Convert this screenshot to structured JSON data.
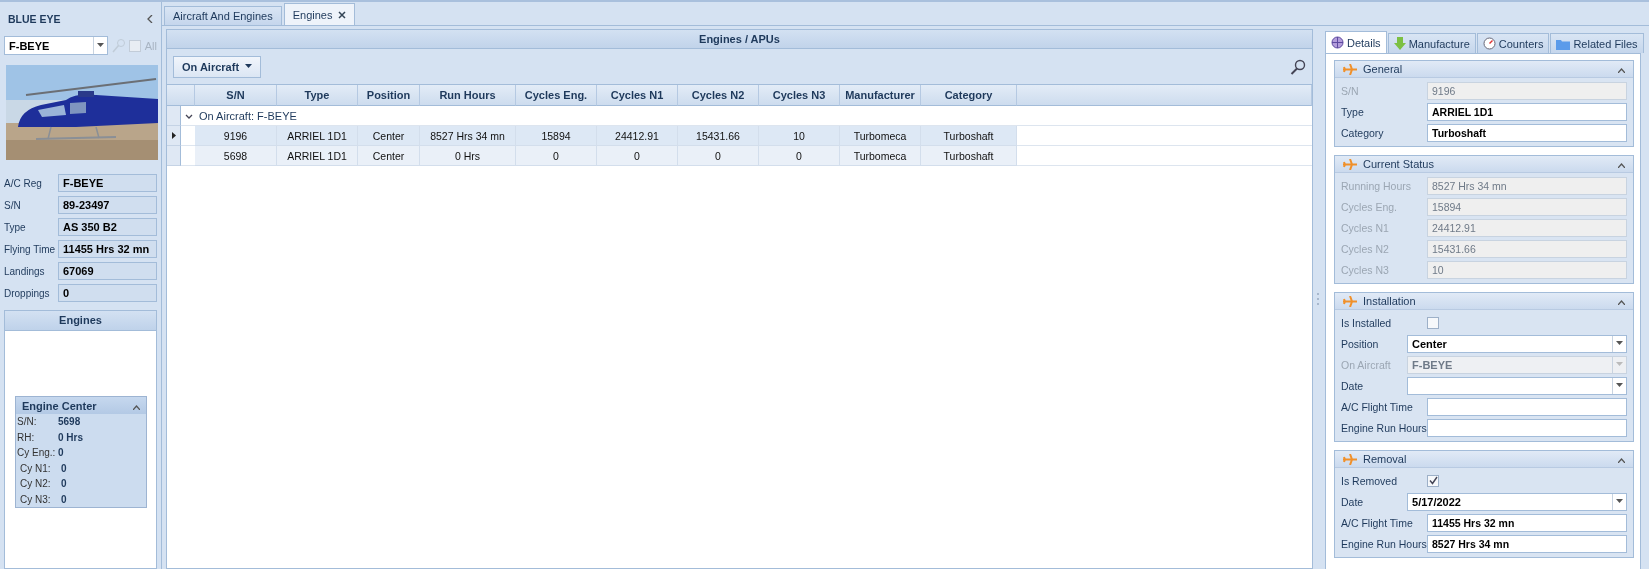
{
  "sidebar": {
    "title": "BLUE EYE",
    "aircraft_select": {
      "value": "F-BEYE"
    },
    "all_checkbox": {
      "label": "All",
      "checked": false,
      "disabled": true
    },
    "fields": [
      {
        "label": "A/C Reg",
        "value": "F-BEYE"
      },
      {
        "label": "S/N",
        "value": "89-23497"
      },
      {
        "label": "Type",
        "value": "AS 350 B2"
      },
      {
        "label": "Flying Time",
        "value": "11455 Hrs 32 mn"
      },
      {
        "label": "Landings",
        "value": "67069"
      },
      {
        "label": "Droppings",
        "value": "0"
      }
    ],
    "engines_panel": {
      "title": "Engines",
      "card": {
        "title": "Engine Center",
        "expanded": true,
        "rows": [
          {
            "label": "S/N:",
            "value": "5698"
          },
          {
            "label": "RH:",
            "value": "0 Hrs"
          },
          {
            "label": "Cy Eng.:",
            "value": "0"
          },
          {
            "label": "Cy N1:",
            "value": "0"
          },
          {
            "label": "Cy N2:",
            "value": "0"
          },
          {
            "label": "Cy N3:",
            "value": "0"
          }
        ]
      }
    }
  },
  "tabs": [
    {
      "label": "Aircraft And Engines",
      "selected": false,
      "closable": false
    },
    {
      "label": "Engines",
      "selected": true,
      "closable": true
    }
  ],
  "grid": {
    "title": "Engines / APUs",
    "filter_button": "On Aircraft",
    "columns": [
      "S/N",
      "Type",
      "Position",
      "Run Hours",
      "Cycles Eng.",
      "Cycles N1",
      "Cycles N2",
      "Cycles N3",
      "Manufacturer",
      "Category"
    ],
    "group": {
      "label": "On Aircraft: F-BEYE",
      "expanded": true
    },
    "rows": [
      {
        "selected": true,
        "cells": [
          "9196",
          "ARRIEL 1D1",
          "Center",
          "8527 Hrs 34 mn",
          "15894",
          "24412.91",
          "15431.66",
          "10",
          "Turbomeca",
          "Turboshaft"
        ]
      },
      {
        "selected": false,
        "cells": [
          "5698",
          "ARRIEL 1D1",
          "Center",
          "0 Hrs",
          "0",
          "0",
          "0",
          "0",
          "Turbomeca",
          "Turboshaft"
        ]
      }
    ]
  },
  "details": {
    "tabs": [
      {
        "label": "Details",
        "selected": true
      },
      {
        "label": "Manufacture",
        "selected": false
      },
      {
        "label": "Counters",
        "selected": false
      },
      {
        "label": "Related Files",
        "selected": false
      }
    ],
    "sections": [
      {
        "title": "General",
        "expanded": true,
        "fields": [
          {
            "kind": "text",
            "label": "S/N",
            "value": "9196",
            "disabled": true
          },
          {
            "kind": "text",
            "label": "Type",
            "value": "ARRIEL 1D1",
            "disabled": false
          },
          {
            "kind": "text",
            "label": "Category",
            "value": "Turboshaft",
            "disabled": false
          }
        ]
      },
      {
        "title": "Current Status",
        "expanded": true,
        "fields": [
          {
            "kind": "text",
            "label": "Running Hours",
            "value": "8527 Hrs 34 mn",
            "disabled": true
          },
          {
            "kind": "text",
            "label": "Cycles Eng.",
            "value": "15894",
            "disabled": true
          },
          {
            "kind": "text",
            "label": "Cycles N1",
            "value": "24412.91",
            "disabled": true
          },
          {
            "kind": "text",
            "label": "Cycles N2",
            "value": "15431.66",
            "disabled": true
          },
          {
            "kind": "text",
            "label": "Cycles N3",
            "value": "10",
            "disabled": true
          }
        ]
      },
      {
        "title": "Installation",
        "expanded": true,
        "fields": [
          {
            "kind": "checkbox",
            "label": "Is Installed",
            "checked": false,
            "disabled": false
          },
          {
            "kind": "combo",
            "label": "Position",
            "value": "Center",
            "disabled": false
          },
          {
            "kind": "combo",
            "label": "On Aircraft",
            "value": "F-BEYE",
            "disabled": true
          },
          {
            "kind": "combo",
            "label": "Date",
            "disabled": false
          },
          {
            "kind": "text",
            "label": "A/C Flight Time",
            "disabled": false
          },
          {
            "kind": "text",
            "label": "Engine Run Hours",
            "disabled": false
          }
        ]
      },
      {
        "title": "Removal",
        "expanded": true,
        "fields": [
          {
            "kind": "checkbox",
            "label": "Is Removed",
            "checked": true,
            "disabled": false
          },
          {
            "kind": "combo",
            "label": "Date",
            "value": "5/17/2022",
            "disabled": false
          },
          {
            "kind": "text",
            "label": "A/C Flight Time",
            "value": "11455 Hrs 32 mn",
            "disabled": false
          },
          {
            "kind": "text",
            "label": "Engine Run Hours",
            "value": "8527 Hrs 34 mn",
            "disabled": false
          }
        ]
      }
    ]
  }
}
